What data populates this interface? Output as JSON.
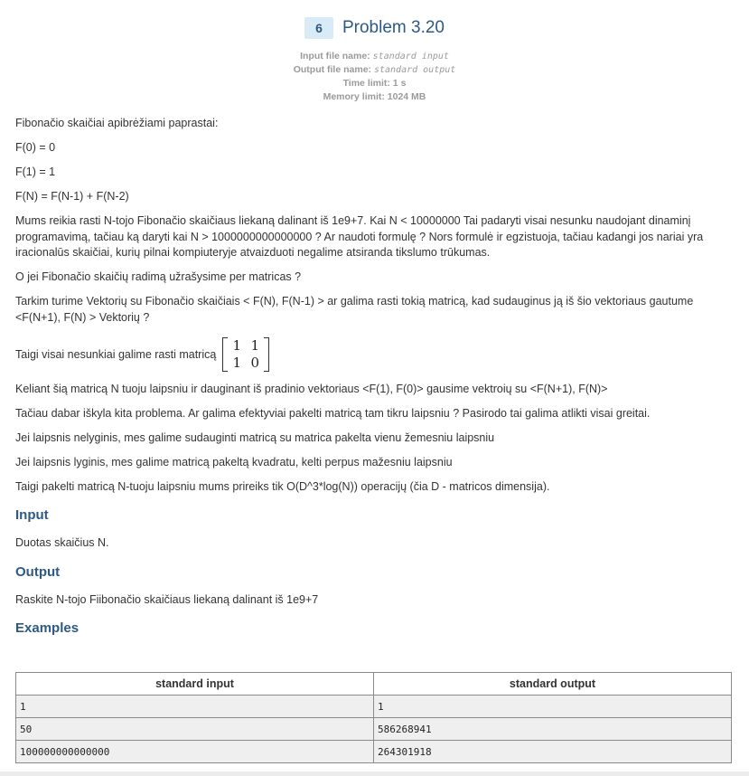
{
  "problem": {
    "number": "6",
    "title": "Problem 3.20",
    "input_file_label": "Input file name:",
    "input_file_value": "standard input",
    "output_file_label": "Output file name:",
    "output_file_value": "standard output",
    "time_limit": "Time limit: 1 s",
    "memory_limit": "Memory limit: 1024 MB"
  },
  "statement": {
    "intro": "Fibonačio skaičiai apibrėžiami paprastai:",
    "f0": "F(0) = 0",
    "f1": "F(1) = 1",
    "fn": "F(N) = F(N-1) + F(N-2)",
    "para1": "Mums reikia rasti N-tojo Fibonačio skaičiaus liekaną dalinant iš 1e9+7. Kai N < 10000000 Tai padaryti visai nesunku naudojant dinaminį programavimą, tačiau ką daryti kai N > 1000000000000000 ? Ar naudoti formulę ? Nors formulė ir egzistuoja, tačiau kadangi jos nariai yra iracionalūs skaičiai, kurių pilnai kompiuteryje atvaizduoti negalime atsiranda tikslumo trūkumas.",
    "para2": "O jei Fibonačio skaičių radimą užrašysime per matricas ?",
    "para3": "Tarkim turime Vektorių su Fibonačio skaičiais < F(N), F(N-1) > ar galima rasti tokią matricą, kad sudauginus ją iš šio vektoriaus gautume <F(N+1), F(N) > Vektorių ?",
    "matrix_intro": "Taigi visai nesunkiai galime rasti matricą",
    "matrix": [
      "1",
      "1",
      "1",
      "0"
    ],
    "para4": "Keliant šią matricą N tuoju laipsniu ir dauginant iš pradinio vektoriaus <F(1), F(0)> gausime vektroių su <F(N+1), F(N)>",
    "para5": "Tačiau dabar iškyla kita problema. Ar galima efektyviai pakelti matricą tam tikru laipsniu ? Pasirodo tai galima atlikti visai greitai.",
    "para6": "Jei laipsnis nelyginis, mes galime sudauginti matricą su matrica pakelta vienu žemesniu laipsniu",
    "para7": "Jei laipsnis lyginis, mes galime matricą pakeltą kvadratu, kelti perpus mažesniu laipsniu",
    "para8": "Taigi pakelti matricą N-tuoju laipsniu mums prireiks tik O(D^3*log(N)) operacijų (čia D - matricos dimensija)."
  },
  "input_section": {
    "heading": "Input",
    "text": "Duotas skaičius N."
  },
  "output_section": {
    "heading": "Output",
    "text": "Raskite N-tojo Fiibonačio skaičiaus liekaną dalinant iš 1e9+7"
  },
  "examples": {
    "heading": "Examples",
    "col_input": "standard input",
    "col_output": "standard output",
    "rows": [
      {
        "input": "1",
        "output": "1"
      },
      {
        "input": "50",
        "output": "586268941"
      },
      {
        "input": "100000000000000",
        "output": "264301918"
      }
    ]
  }
}
